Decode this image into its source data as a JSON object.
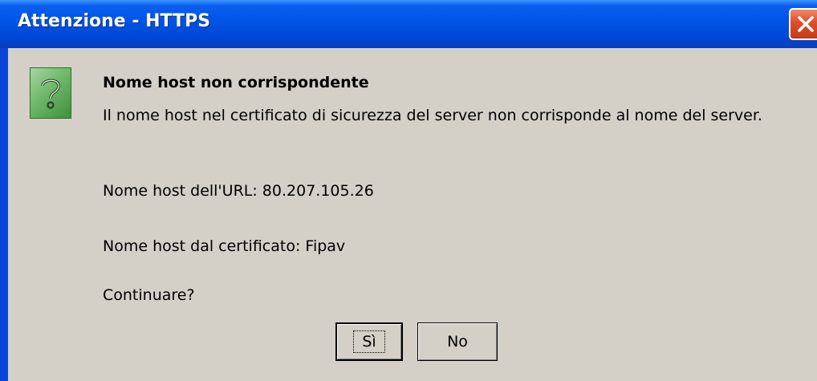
{
  "window": {
    "title": "Attenzione - HTTPS"
  },
  "icon": {
    "name": "question-icon"
  },
  "message": {
    "heading": "Nome host non corrispondente",
    "body": "Il nome host nel certificato di sicurezza del server non corrisponde al nome del server.",
    "url_host": "Nome host dell'URL: 80.207.105.26",
    "cert_host": "Nome host dal certificato: Fipav",
    "question": "Continuare?"
  },
  "buttons": {
    "yes": "Sì",
    "no": "No"
  }
}
